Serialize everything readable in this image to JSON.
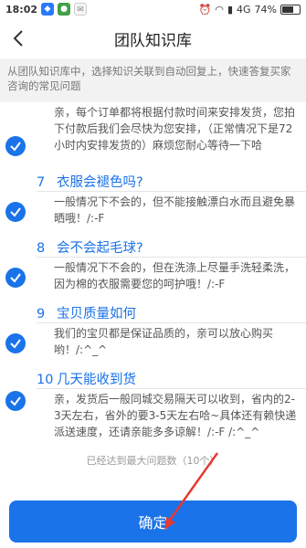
{
  "status_bar": {
    "time": "18:02",
    "right_text": "4G",
    "battery_percent": "74%",
    "battery_level": 0.74
  },
  "header": {
    "title": "团队知识库"
  },
  "notice": {
    "text": "从团队知识库中，选择知识关联到自动回复上，快速答复买家咨询的常见问题"
  },
  "qa_items": [
    {
      "number": "",
      "question": "",
      "answer": "亲，每个订单都将根据付款时间来安排发货，您拍下付款后我们会尽快为您安排，（正常情况下是72小时内安排发货的）麻烦您耐心等待一下哈"
    },
    {
      "number": "7",
      "question": "衣服会褪色吗?",
      "answer": "一般情况下不会的，但不能接触漂白水而且避免暴晒哦！/:-F"
    },
    {
      "number": "8",
      "question": "会不会起毛球?",
      "answer": "一般情况下不会的，但在洗涤上尽量手洗轻柔洗，因为棉的衣服需要您的呵护哦！/:-F"
    },
    {
      "number": "9",
      "question": "宝贝质量如何",
      "answer": "我们的宝贝都是保证品质的，亲可以放心购买哟！/:^_^"
    },
    {
      "number": "10",
      "question": "几天能收到货",
      "answer": "亲，发货后一般同城交易隔天可以收到，省内的2-3天左右，省外的要3-5天左右哈~具体还有赖快递派送速度，还请亲能多多谅解！/:-F /:^_^"
    }
  ],
  "limit_text": "已经达到最大问题数（10个）",
  "confirm_label": "确定",
  "colors": {
    "accent": "#1a73e8",
    "annotation_arrow": "#e53935"
  }
}
